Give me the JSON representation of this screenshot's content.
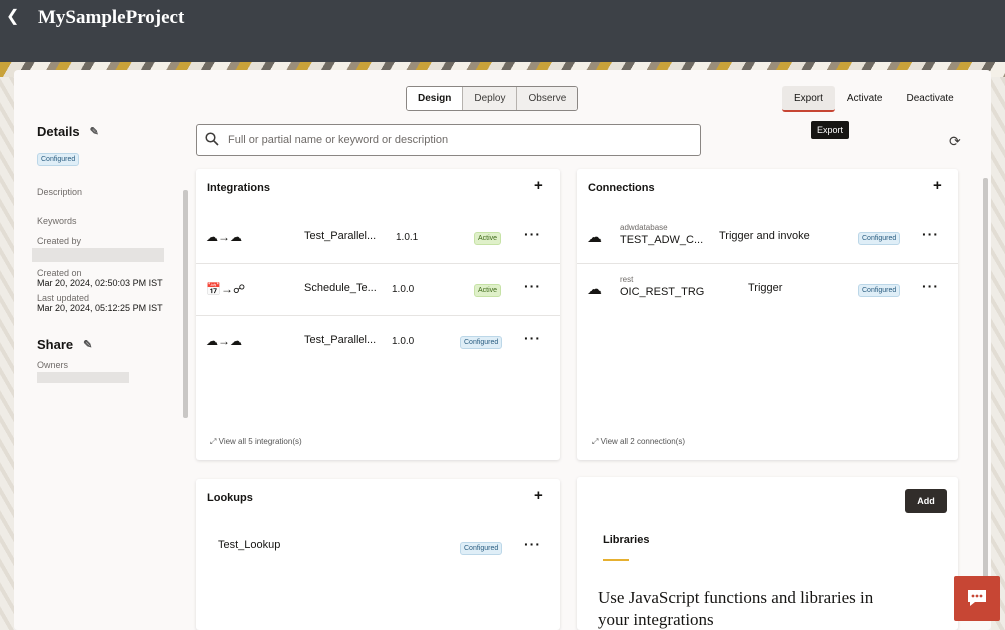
{
  "header": {
    "back_icon": "chevron-left-icon",
    "title": "MySampleProject"
  },
  "tabs": [
    "Design",
    "Deploy",
    "Observe"
  ],
  "actions": {
    "export": "Export",
    "activate": "Activate",
    "deactivate": "Deactivate",
    "tooltip": "Export"
  },
  "details": {
    "title": "Details",
    "status": "Configured",
    "description_label": "Description",
    "keywords_label": "Keywords",
    "created_by_label": "Created by",
    "created_on_label": "Created on",
    "created_on": "Mar 20, 2024, 02:50:03 PM IST",
    "updated_label": "Last updated",
    "updated_on": "Mar 20, 2024, 05:12:25 PM IST"
  },
  "share": {
    "title": "Share",
    "owners_label": "Owners"
  },
  "search": {
    "placeholder": "Full or partial name or keyword or description"
  },
  "integrations": {
    "title": "Integrations",
    "rows": [
      {
        "name": "Test_Parallel...",
        "version": "1.0.1",
        "status": "Active"
      },
      {
        "name": "Schedule_Te...",
        "version": "1.0.0",
        "status": "Active"
      },
      {
        "name": "Test_Parallel...",
        "version": "1.0.0",
        "status": "Configured"
      }
    ],
    "view_all": "View all 5 integration(s)"
  },
  "connections": {
    "title": "Connections",
    "rows": [
      {
        "type": "adwdatabase",
        "name": "TEST_ADW_C...",
        "role": "Trigger and invoke",
        "status": "Configured"
      },
      {
        "type": "rest",
        "name": "OIC_REST_TRG",
        "role": "Trigger",
        "status": "Configured"
      }
    ],
    "view_all": "View all 2 connection(s)"
  },
  "lookups": {
    "title": "Lookups",
    "rows": [
      {
        "name": "Test_Lookup",
        "status": "Configured"
      }
    ]
  },
  "libraries": {
    "add_label": "Add",
    "title": "Libraries",
    "description": "Use JavaScript functions and libraries in your integrations"
  },
  "colors": {
    "header": "#3d4147",
    "accent": "#c74634",
    "active_badge": "#dff0c9",
    "configured_badge": "#dfeef7"
  }
}
